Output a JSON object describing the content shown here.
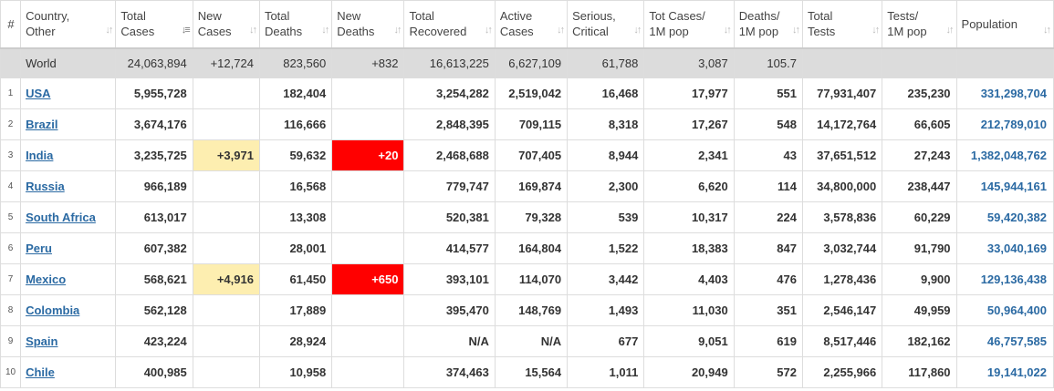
{
  "columns": [
    {
      "key": "idx",
      "label": "#"
    },
    {
      "key": "country",
      "label1": "Country,",
      "label2": "Other"
    },
    {
      "key": "total_cases",
      "label1": "Total",
      "label2": "Cases"
    },
    {
      "key": "new_cases",
      "label1": "New",
      "label2": "Cases"
    },
    {
      "key": "total_deaths",
      "label1": "Total",
      "label2": "Deaths"
    },
    {
      "key": "new_deaths",
      "label1": "New",
      "label2": "Deaths"
    },
    {
      "key": "total_recovered",
      "label1": "Total",
      "label2": "Recovered"
    },
    {
      "key": "active_cases",
      "label1": "Active",
      "label2": "Cases"
    },
    {
      "key": "serious",
      "label1": "Serious,",
      "label2": "Critical"
    },
    {
      "key": "tot_cases_1m",
      "label1": "Tot Cases/",
      "label2": "1M pop"
    },
    {
      "key": "deaths_1m",
      "label1": "Deaths/",
      "label2": "1M pop"
    },
    {
      "key": "total_tests",
      "label1": "Total",
      "label2": "Tests"
    },
    {
      "key": "tests_1m",
      "label1": "Tests/",
      "label2": "1M pop"
    },
    {
      "key": "population",
      "label": "Population"
    }
  ],
  "world": {
    "country": "World",
    "total_cases": "24,063,894",
    "new_cases": "+12,724",
    "total_deaths": "823,560",
    "new_deaths": "+832",
    "total_recovered": "16,613,225",
    "active_cases": "6,627,109",
    "serious": "61,788",
    "tot_cases_1m": "3,087",
    "deaths_1m": "105.7",
    "total_tests": "",
    "tests_1m": "",
    "population": ""
  },
  "rows": [
    {
      "idx": "1",
      "country": "USA",
      "total_cases": "5,955,728",
      "new_cases": "",
      "total_deaths": "182,404",
      "new_deaths": "",
      "total_recovered": "3,254,282",
      "active_cases": "2,519,042",
      "serious": "16,468",
      "tot_cases_1m": "17,977",
      "deaths_1m": "551",
      "total_tests": "77,931,407",
      "tests_1m": "235,230",
      "population": "331,298,704"
    },
    {
      "idx": "2",
      "country": "Brazil",
      "total_cases": "3,674,176",
      "new_cases": "",
      "total_deaths": "116,666",
      "new_deaths": "",
      "total_recovered": "2,848,395",
      "active_cases": "709,115",
      "serious": "8,318",
      "tot_cases_1m": "17,267",
      "deaths_1m": "548",
      "total_tests": "14,172,764",
      "tests_1m": "66,605",
      "population": "212,789,010"
    },
    {
      "idx": "3",
      "country": "India",
      "total_cases": "3,235,725",
      "new_cases": "+3,971",
      "total_deaths": "59,632",
      "new_deaths": "+20",
      "total_recovered": "2,468,688",
      "active_cases": "707,405",
      "serious": "8,944",
      "tot_cases_1m": "2,341",
      "deaths_1m": "43",
      "total_tests": "37,651,512",
      "tests_1m": "27,243",
      "population": "1,382,048,762"
    },
    {
      "idx": "4",
      "country": "Russia",
      "total_cases": "966,189",
      "new_cases": "",
      "total_deaths": "16,568",
      "new_deaths": "",
      "total_recovered": "779,747",
      "active_cases": "169,874",
      "serious": "2,300",
      "tot_cases_1m": "6,620",
      "deaths_1m": "114",
      "total_tests": "34,800,000",
      "tests_1m": "238,447",
      "population": "145,944,161"
    },
    {
      "idx": "5",
      "country": "South Africa",
      "total_cases": "613,017",
      "new_cases": "",
      "total_deaths": "13,308",
      "new_deaths": "",
      "total_recovered": "520,381",
      "active_cases": "79,328",
      "serious": "539",
      "tot_cases_1m": "10,317",
      "deaths_1m": "224",
      "total_tests": "3,578,836",
      "tests_1m": "60,229",
      "population": "59,420,382"
    },
    {
      "idx": "6",
      "country": "Peru",
      "total_cases": "607,382",
      "new_cases": "",
      "total_deaths": "28,001",
      "new_deaths": "",
      "total_recovered": "414,577",
      "active_cases": "164,804",
      "serious": "1,522",
      "tot_cases_1m": "18,383",
      "deaths_1m": "847",
      "total_tests": "3,032,744",
      "tests_1m": "91,790",
      "population": "33,040,169"
    },
    {
      "idx": "7",
      "country": "Mexico",
      "total_cases": "568,621",
      "new_cases": "+4,916",
      "total_deaths": "61,450",
      "new_deaths": "+650",
      "total_recovered": "393,101",
      "active_cases": "114,070",
      "serious": "3,442",
      "tot_cases_1m": "4,403",
      "deaths_1m": "476",
      "total_tests": "1,278,436",
      "tests_1m": "9,900",
      "population": "129,136,438"
    },
    {
      "idx": "8",
      "country": "Colombia",
      "total_cases": "562,128",
      "new_cases": "",
      "total_deaths": "17,889",
      "new_deaths": "",
      "total_recovered": "395,470",
      "active_cases": "148,769",
      "serious": "1,493",
      "tot_cases_1m": "11,030",
      "deaths_1m": "351",
      "total_tests": "2,546,147",
      "tests_1m": "49,959",
      "population": "50,964,400"
    },
    {
      "idx": "9",
      "country": "Spain",
      "total_cases": "423,224",
      "new_cases": "",
      "total_deaths": "28,924",
      "new_deaths": "",
      "total_recovered": "N/A",
      "active_cases": "N/A",
      "serious": "677",
      "tot_cases_1m": "9,051",
      "deaths_1m": "619",
      "total_tests": "8,517,446",
      "tests_1m": "182,162",
      "population": "46,757,585"
    },
    {
      "idx": "10",
      "country": "Chile",
      "total_cases": "400,985",
      "new_cases": "",
      "total_deaths": "10,958",
      "new_deaths": "",
      "total_recovered": "374,463",
      "active_cases": "15,564",
      "serious": "1,011",
      "tot_cases_1m": "20,949",
      "deaths_1m": "572",
      "total_tests": "2,255,966",
      "tests_1m": "117,860",
      "population": "19,141,022"
    }
  ],
  "colors": {
    "link": "#2b6aa3",
    "world_bg": "#dcdcdc",
    "new_cases_highlight": "#fdeeb0",
    "new_deaths_highlight": "#ff0000"
  },
  "icons": {
    "sort": "sort-arrows-icon"
  }
}
